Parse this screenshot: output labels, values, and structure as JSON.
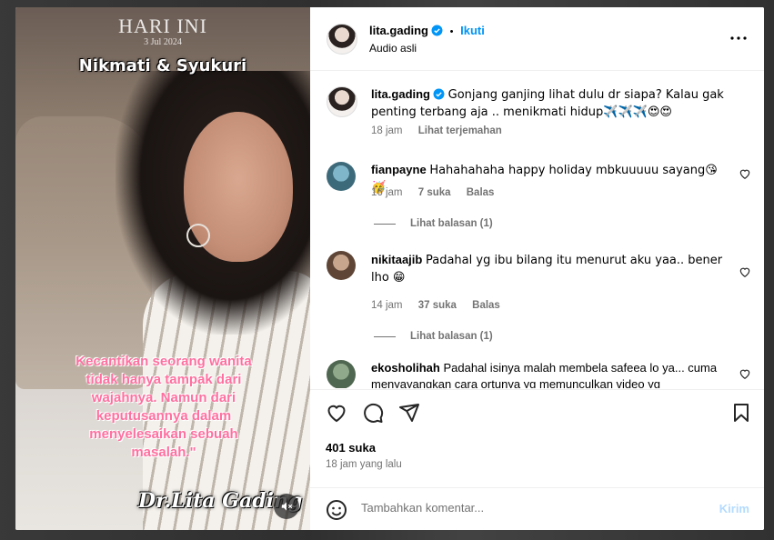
{
  "media": {
    "overlay_title": "HARI INI",
    "overlay_date": "3 Jul 2024",
    "headline": "Nikmati & Syukuri",
    "quote": "Kecantikan seorang wanita tidak hanya tampak dari wajahnya. Namun dari keputusannya dalam menyelesaikan sebuah masalah.\"",
    "signature": "Dr.Lita Gading"
  },
  "header": {
    "username": "lita.gading",
    "separator": "•",
    "follow_label": "Ikuti",
    "audio_label": "Audio asli"
  },
  "caption": {
    "username": "lita.gading",
    "text": "Gonjang ganjing lihat dulu dr siapa? Kalau gak penting terbang aja .. menikmati hidup✈️✈️✈️😍😍",
    "time": "18 jam",
    "translate_label": "Lihat terjemahan"
  },
  "comments": [
    {
      "username": "fianpayne",
      "text": "Hahahahaha happy holiday mbkuuuuu sayang😘🥳",
      "time": "16 jam",
      "likes": "7 suka",
      "reply_label": "Balas",
      "view_replies": "Lihat balasan (1)"
    },
    {
      "username": "nikitaajib",
      "text": "Padahal yg ibu bilang itu menurut aku yaa.. bener lho 😁",
      "time": "14 jam",
      "likes": "37 suka",
      "reply_label": "Balas",
      "view_replies": "Lihat balasan (1)"
    },
    {
      "username": "ekosholihah",
      "text": "Padahal isinya malah membela safeea lo ya... cuma menyayangkan cara ortunya yg memunculkan video yg"
    }
  ],
  "actions": {
    "likes_count": "401 suka",
    "time_ago": "18 jam yang lalu"
  },
  "add_comment": {
    "placeholder": "Tambahkan komentar...",
    "post_label": "Kirim"
  },
  "colors": {
    "accent_blue": "#0095f6",
    "post_disabled": "#b3dbff",
    "muted_text": "#737373",
    "quote_pink": "#ff6fa0"
  }
}
